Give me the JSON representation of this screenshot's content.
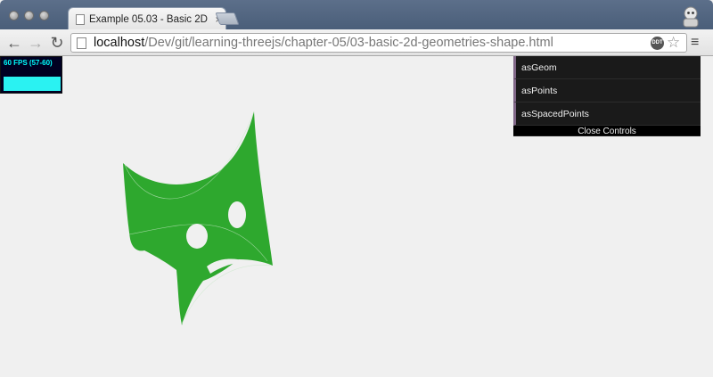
{
  "browser": {
    "tab_title": "Example 05.03 - Basic 2D",
    "tab_close": "×",
    "url_host": "localhost",
    "url_path": "/Dev/git/learning-threejs/chapter-05/03-basic-2d-geometries-shape.html",
    "extension_badge": "DDT"
  },
  "stats": {
    "fps_text": "60 FPS (57-60)",
    "accent_color": "#00ffff"
  },
  "controls": {
    "items": [
      "asGeom",
      "asPoints",
      "asSpacedPoints"
    ],
    "close_label": "Close Controls"
  },
  "scene": {
    "shape_color": "#2ea82e",
    "background": "#f0f0f0"
  }
}
